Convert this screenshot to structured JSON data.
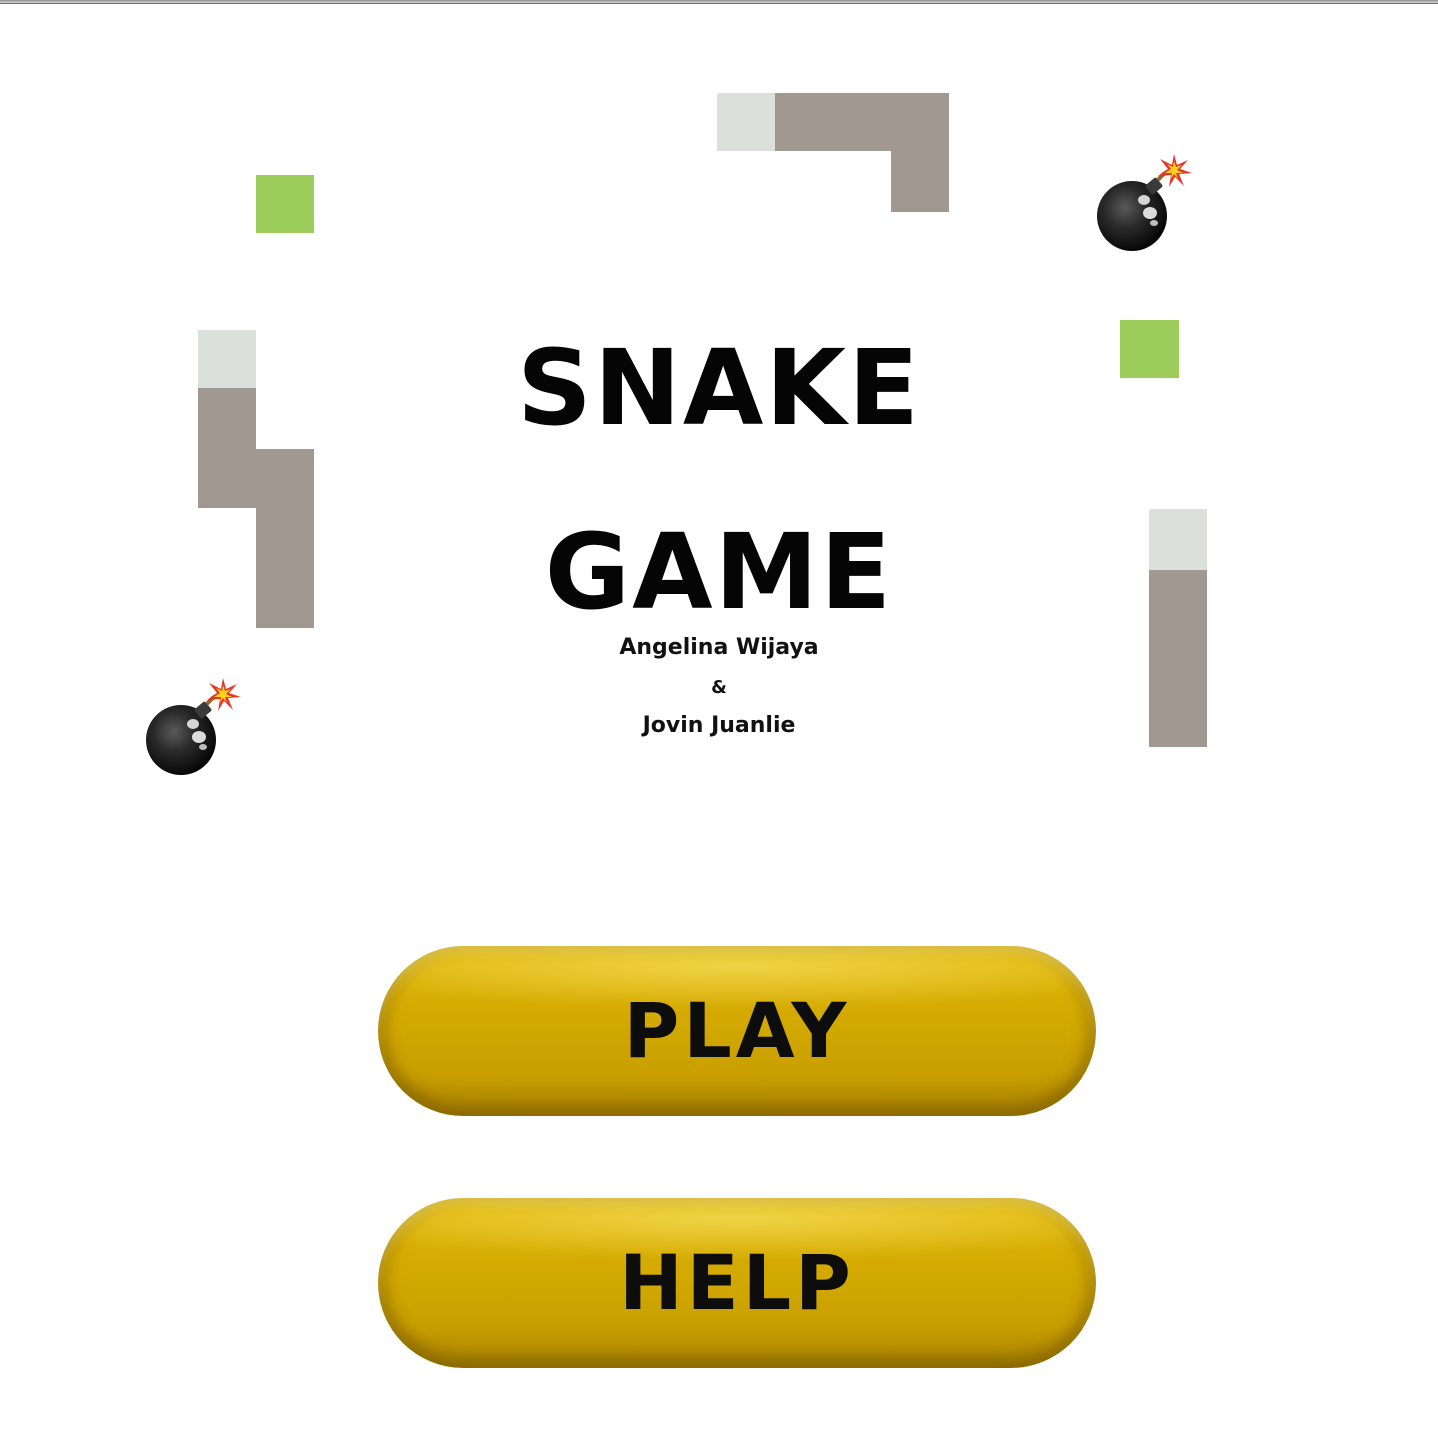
{
  "title": {
    "line1": "SNAKE",
    "line2": "GAME"
  },
  "credits": {
    "author1": "Angelina Wijaya",
    "ampersand": "&",
    "author2": "Jovin Juanlie"
  },
  "menu": {
    "play_label": "PLAY",
    "help_label": "HELP"
  },
  "decorations": {
    "snake_count": 3,
    "food_count": 2,
    "bomb_count": 2,
    "bomb_icon": "bomb-icon"
  },
  "colors": {
    "snake_head": "#dbe0dd",
    "snake_body": "#a19891",
    "food": "#9ccd5a",
    "button": "#d4aa02",
    "title_text": "#050505"
  }
}
